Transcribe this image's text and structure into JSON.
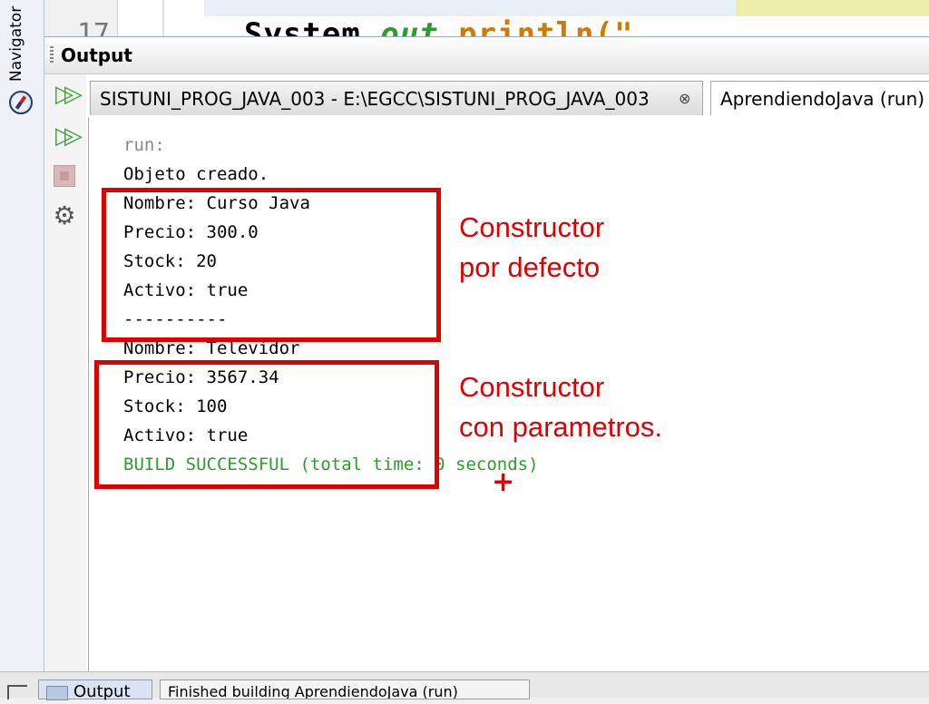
{
  "navigator": {
    "label": "Navigator",
    "icon": "compass-icon"
  },
  "editor": {
    "line_number": "17",
    "code_prefix": "System.",
    "code_out": "out",
    "code_suffix": ".println(\""
  },
  "output_window": {
    "title": "Output",
    "tabs": [
      {
        "label": "SISTUNI_PROG_JAVA_003 - E:\\EGCC\\SISTUNI_PROG_JAVA_003",
        "close": "⊗"
      },
      {
        "label": "AprendiendoJava (run)"
      }
    ],
    "toolbar": {
      "rerun": "▷▷",
      "rerun_with_params": "▷▷",
      "settings": "⚙"
    }
  },
  "console": {
    "lines": [
      "run:",
      "Objeto creado.",
      "Nombre: Curso Java",
      "Precio: 300.0",
      "Stock: 20",
      "Activo: true",
      "----------",
      "Nombre: Televidor",
      "Precio: 3567.34",
      "Stock: 100",
      "Activo: true",
      "BUILD SUCCESSFUL (total time: 0 seconds)"
    ]
  },
  "annotations": {
    "note1_line1": "Constructor",
    "note1_line2": "por defecto",
    "note2_line1": "Constructor",
    "note2_line2": "con parametros.",
    "cursor": "+"
  },
  "bottom_bar": {
    "output_tab": "Output",
    "status_tab": "Finished building AprendiendoJava (run)"
  },
  "colors": {
    "annotation_red": "#e00000",
    "build_success_green": "#2e9b2e"
  }
}
